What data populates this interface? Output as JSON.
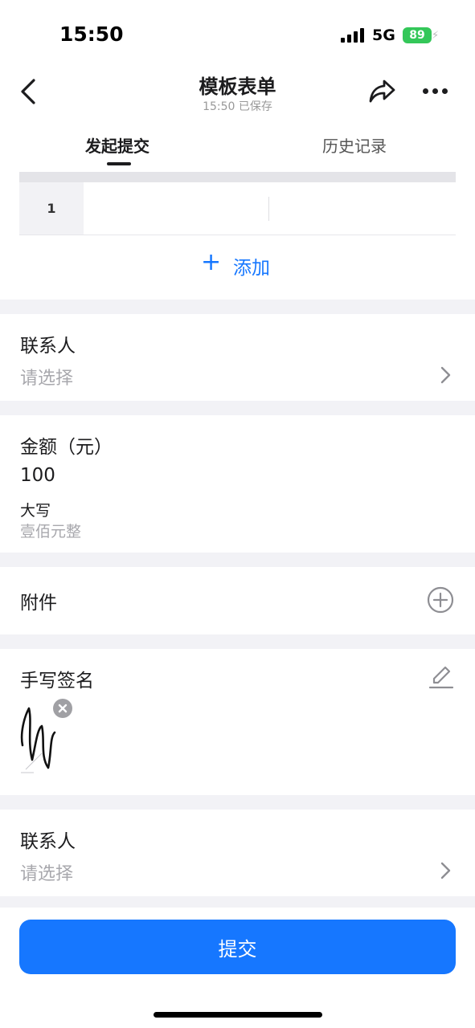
{
  "status_bar": {
    "time": "15:50",
    "network": "5G",
    "battery": "89"
  },
  "nav": {
    "title": "模板表单",
    "subtitle": "15:50 已保存"
  },
  "tabs": [
    {
      "label": "发起提交",
      "active": true
    },
    {
      "label": "历史记录",
      "active": false
    }
  ],
  "table": {
    "rows": [
      {
        "index": "1"
      }
    ],
    "add_label": "添加"
  },
  "contact_1": {
    "label": "联系人",
    "placeholder": "请选择"
  },
  "amount": {
    "label": "金额（元）",
    "value": "100",
    "uppercase_label": "大写",
    "uppercase_value": "壹佰元整"
  },
  "attachment": {
    "label": "附件"
  },
  "signature": {
    "label": "手写签名"
  },
  "contact_2": {
    "label": "联系人",
    "placeholder": "请选择"
  },
  "submit": {
    "label": "提交"
  },
  "colors": {
    "accent": "#1677ff",
    "battery": "#34c759",
    "background": "#f2f2f6",
    "placeholder": "#a8a8ad"
  }
}
